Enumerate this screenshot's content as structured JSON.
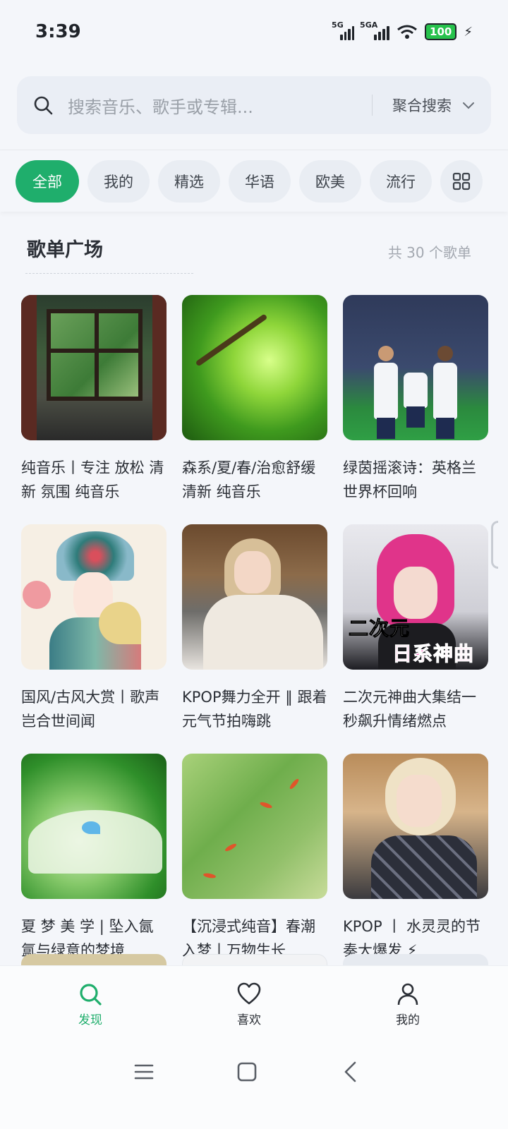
{
  "status_bar": {
    "time": "3:39",
    "signal1_label": "5G",
    "signal2_label": "5GA",
    "battery": "100"
  },
  "search": {
    "placeholder": "搜索音乐、歌手或专辑...",
    "mode": "聚合搜索"
  },
  "categories": [
    "全部",
    "我的",
    "精选",
    "华语",
    "欧美",
    "流行"
  ],
  "section": {
    "title": "歌单广场",
    "count": "共 30 个歌单"
  },
  "playlists": [
    {
      "title": "纯音乐丨专注 放松 清新 氛围 纯音乐"
    },
    {
      "title": "森系/夏/春/治愈舒缓 清新 纯音乐"
    },
    {
      "title": "绿茵摇滚诗：英格兰世界杯回响"
    },
    {
      "title": "国风/古风大赏丨歌声岂合世间闻"
    },
    {
      "title": "KPOP舞力全开 ‖ 跟着元气节拍嗨跳"
    },
    {
      "title": "二次元神曲大集结一秒飙升情绪燃点"
    },
    {
      "title": "夏 梦 美 学 | 坠入氤氲与绿意的梦境"
    },
    {
      "title": "【沉浸式纯音】春潮入梦丨万物生长"
    },
    {
      "title": "KPOP 丨 水灵灵的节奏大爆发 ⚡"
    }
  ],
  "cover_texts": {
    "anime_line1": "二次元",
    "anime_line2": "日系神曲"
  },
  "bottom_nav": {
    "discover": "发现",
    "like": "喜欢",
    "mine": "我的"
  },
  "colors": {
    "accent": "#1fae6c",
    "background": "#f4f6fa"
  }
}
